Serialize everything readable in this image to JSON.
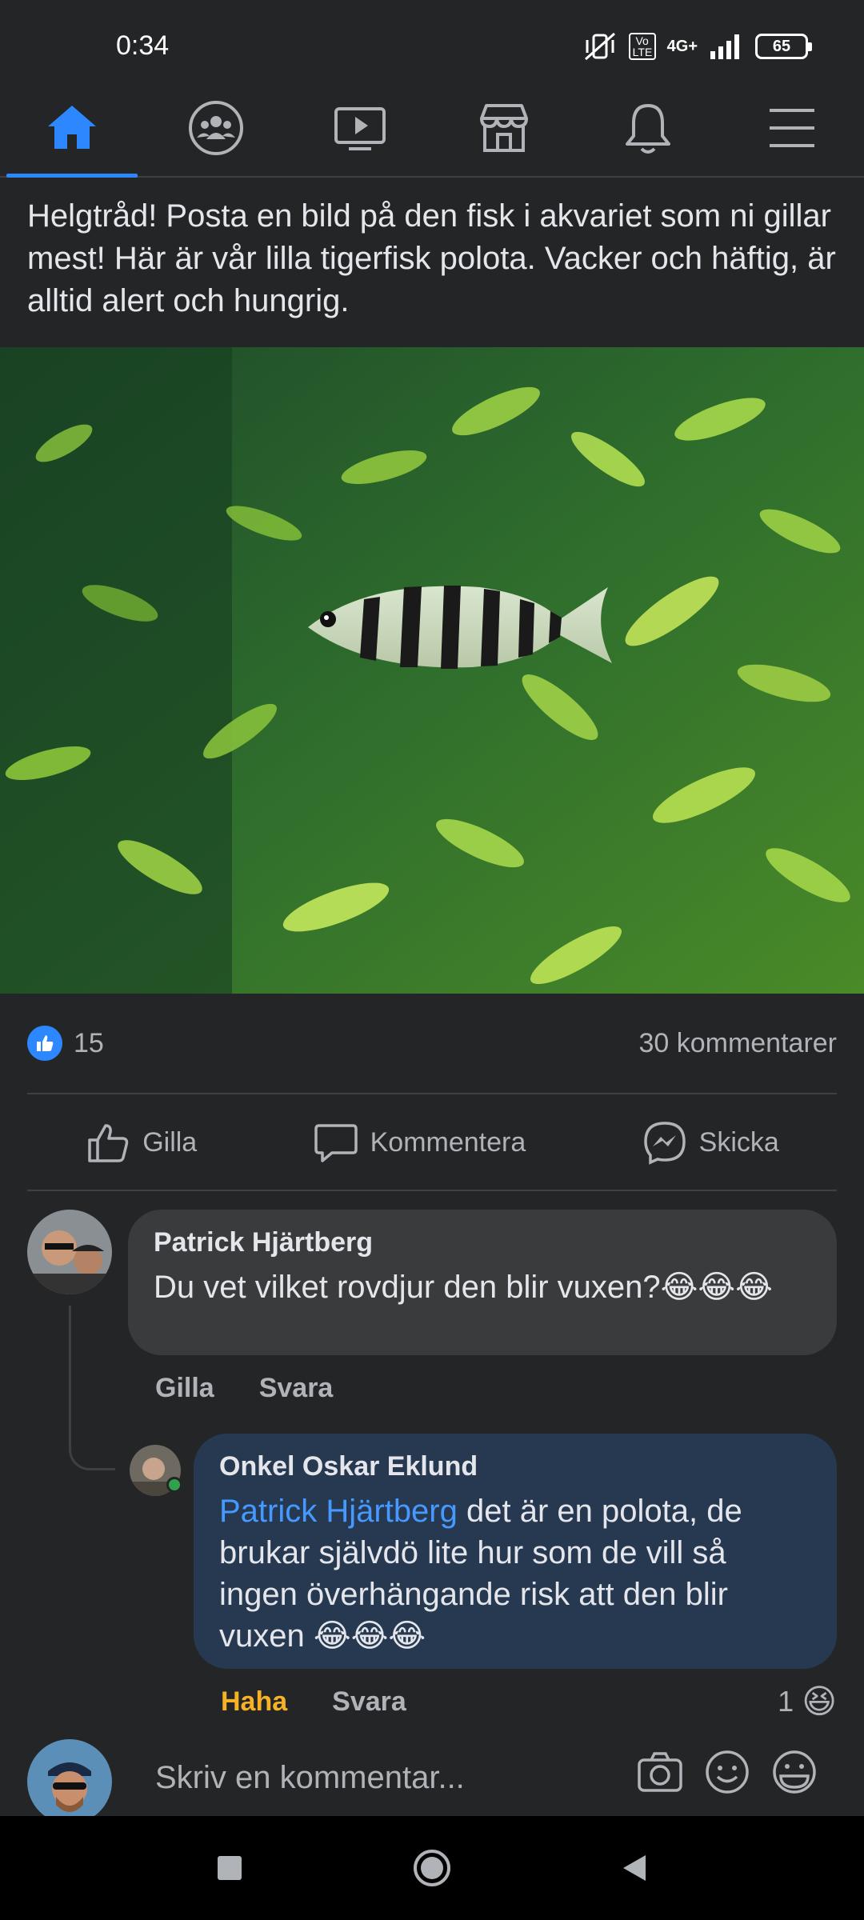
{
  "status": {
    "time": "0:34",
    "network": "4G+",
    "volte": "Vo LTE",
    "battery": "65"
  },
  "nav": {
    "items": [
      {
        "name": "home",
        "active": true
      },
      {
        "name": "groups",
        "active": false
      },
      {
        "name": "watch",
        "active": false
      },
      {
        "name": "marketplace",
        "active": false
      },
      {
        "name": "notifications",
        "active": false
      },
      {
        "name": "menu",
        "active": false
      }
    ]
  },
  "post": {
    "text": "Helgtråd! Posta en bild på den fisk i akvariet som ni gillar mest! Här är vår lilla tigerfisk polota. Vacker och häftig, är alltid alert och hungrig.",
    "likes": "15",
    "comments_count": "30 kommentarer"
  },
  "actions": {
    "like": "Gilla",
    "comment": "Kommentera",
    "send": "Skicka"
  },
  "comments": [
    {
      "author": "Patrick Hjärtberg",
      "text": "Du vet vilket rovdjur den blir vuxen?😂😂😂",
      "like_label": "Gilla",
      "reply_label": "Svara"
    },
    {
      "author": "Onkel Oskar Eklund",
      "mention": "Patrick Hjärtberg",
      "text": " det är en polota, de brukar självdö lite hur som de vill så ingen överhängande risk att den blir vuxen 😂😂😂",
      "like_label": "Haha",
      "reply_label": "Svara",
      "reaction_count": "1",
      "reaction_emoji": "😆"
    }
  ],
  "composer": {
    "placeholder": "Skriv en kommentar..."
  },
  "colors": {
    "background": "#242526",
    "accent": "#2d88ff",
    "mention": "#4599ff",
    "haha": "#f7b125"
  }
}
